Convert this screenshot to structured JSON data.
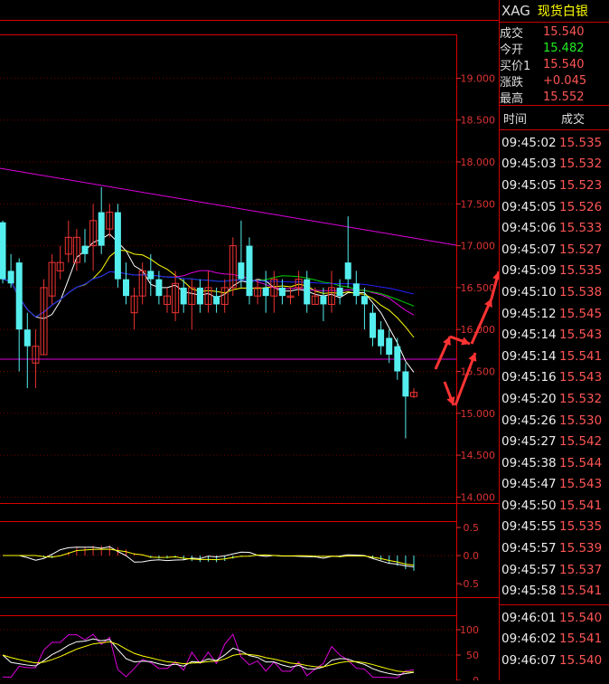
{
  "quote": {
    "symbol": "XAG",
    "name": "现货白银",
    "rows": [
      {
        "label": "成交",
        "value": "15.540"
      },
      {
        "label": "今开",
        "value": "15.482"
      },
      {
        "label": "买价1",
        "value": "15.540"
      },
      {
        "label": "涨跌",
        "value": "+0.045"
      },
      {
        "label": "最高",
        "value": "15.552"
      }
    ]
  },
  "ticks": {
    "headers": {
      "time": "时间",
      "price": "成交"
    },
    "rows_a": [
      {
        "time": "09:45:02",
        "price": "15.535"
      },
      {
        "time": "09:45:03",
        "price": "15.532"
      },
      {
        "time": "09:45:05",
        "price": "15.523"
      },
      {
        "time": "09:45:05",
        "price": "15.526"
      },
      {
        "time": "09:45:06",
        "price": "15.533"
      },
      {
        "time": "09:45:07",
        "price": "15.527"
      },
      {
        "time": "09:45:09",
        "price": "15.535"
      },
      {
        "time": "09:45:10",
        "price": "15.538"
      },
      {
        "time": "09:45:12",
        "price": "15.545"
      },
      {
        "time": "09:45:14",
        "price": "15.543"
      },
      {
        "time": "09:45:14",
        "price": "15.541"
      },
      {
        "time": "09:45:16",
        "price": "15.543"
      },
      {
        "time": "09:45:20",
        "price": "15.532"
      },
      {
        "time": "09:45:26",
        "price": "15.530"
      },
      {
        "time": "09:45:27",
        "price": "15.542"
      },
      {
        "time": "09:45:38",
        "price": "15.544"
      },
      {
        "time": "09:45:47",
        "price": "15.543"
      },
      {
        "time": "09:45:50",
        "price": "15.541"
      },
      {
        "time": "09:45:55",
        "price": "15.535"
      },
      {
        "time": "09:45:57",
        "price": "15.539"
      },
      {
        "time": "09:45:57",
        "price": "15.537"
      },
      {
        "time": "09:45:58",
        "price": "15.541"
      }
    ],
    "rows_b": [
      {
        "time": "09:46:01",
        "price": "15.540"
      },
      {
        "time": "09:46:02",
        "price": "15.541"
      },
      {
        "time": "09:46:07",
        "price": "15.540"
      }
    ]
  },
  "chart": {
    "price_axis": [
      "19.000",
      "18.500",
      "18.000",
      "17.500",
      "17.000",
      "16.500",
      "16.000",
      "15.500",
      "15.000",
      "14.500",
      "14.000"
    ],
    "macd_axis": [
      "0.5",
      "0.0",
      "-0.5"
    ],
    "kdj_axis": [
      "100",
      "50",
      "0"
    ],
    "candles": [
      [
        17.28,
        16.6,
        17.3,
        16.55
      ],
      [
        16.7,
        16.55,
        16.9,
        16.5
      ],
      [
        16.8,
        16.0,
        16.85,
        15.5
      ],
      [
        16.0,
        15.8,
        16.2,
        15.3
      ],
      [
        15.6,
        15.8,
        16.0,
        15.3
      ],
      [
        15.7,
        16.5,
        16.6,
        15.7
      ],
      [
        16.4,
        16.8,
        16.9,
        16.3
      ],
      [
        16.7,
        16.8,
        17.0,
        16.6
      ],
      [
        16.9,
        17.1,
        17.3,
        16.8
      ],
      [
        16.8,
        17.1,
        17.2,
        16.7
      ],
      [
        17.0,
        16.9,
        17.2,
        16.8
      ],
      [
        17.0,
        17.3,
        17.5,
        16.7
      ],
      [
        17.4,
        17.0,
        17.7,
        16.9
      ],
      [
        17.2,
        17.4,
        17.5,
        17.1
      ],
      [
        17.4,
        16.6,
        17.5,
        16.5
      ],
      [
        16.6,
        16.4,
        16.8,
        16.3
      ],
      [
        16.2,
        16.4,
        16.5,
        16.0
      ],
      [
        16.4,
        16.7,
        16.8,
        16.3
      ],
      [
        16.7,
        16.6,
        16.9,
        16.4
      ],
      [
        16.6,
        16.4,
        16.7,
        16.3
      ],
      [
        16.3,
        16.4,
        16.5,
        16.2
      ],
      [
        16.2,
        16.55,
        16.7,
        16.1
      ],
      [
        16.5,
        16.3,
        16.6,
        16.2
      ],
      [
        16.3,
        16.5,
        16.6,
        16.0
      ],
      [
        16.5,
        16.3,
        16.6,
        16.2
      ],
      [
        16.3,
        16.5,
        16.7,
        16.2
      ],
      [
        16.4,
        16.3,
        16.5,
        16.2
      ],
      [
        16.3,
        16.5,
        16.6,
        16.2
      ],
      [
        16.5,
        17.0,
        17.1,
        16.4
      ],
      [
        16.8,
        16.6,
        17.3,
        16.5
      ],
      [
        17.0,
        16.4,
        17.1,
        16.3
      ],
      [
        16.4,
        16.5,
        16.6,
        16.3
      ],
      [
        16.5,
        16.4,
        16.7,
        16.2
      ],
      [
        16.4,
        16.6,
        16.7,
        16.2
      ],
      [
        16.5,
        16.4,
        16.6,
        16.3
      ],
      [
        16.4,
        16.4,
        16.5,
        16.3
      ],
      [
        16.5,
        16.6,
        16.7,
        16.4
      ],
      [
        16.6,
        16.3,
        16.7,
        16.2
      ],
      [
        16.3,
        16.4,
        16.5,
        16.3
      ],
      [
        16.4,
        16.3,
        16.5,
        16.1
      ],
      [
        16.3,
        16.5,
        16.7,
        16.2
      ],
      [
        16.5,
        16.4,
        16.6,
        16.3
      ],
      [
        16.8,
        16.6,
        17.35,
        16.5
      ],
      [
        16.55,
        16.4,
        16.7,
        16.3
      ],
      [
        16.4,
        16.3,
        16.5,
        16.0
      ],
      [
        16.2,
        15.9,
        16.3,
        15.8
      ],
      [
        16.0,
        15.8,
        16.1,
        15.7
      ],
      [
        15.9,
        15.7,
        16.0,
        15.6
      ],
      [
        15.8,
        15.5,
        15.9,
        15.4
      ],
      [
        15.5,
        15.2,
        15.6,
        14.7
      ],
      [
        15.2,
        15.25,
        15.3,
        15.18
      ]
    ]
  }
}
